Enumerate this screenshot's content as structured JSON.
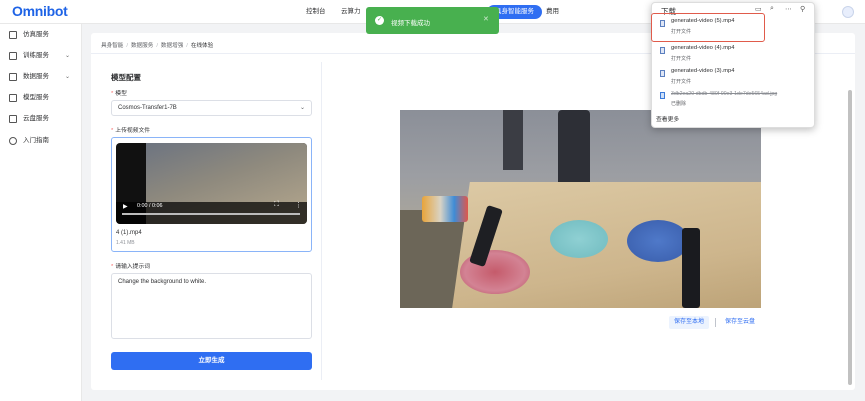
{
  "app": {
    "logo": "Omnibot"
  },
  "topnav": {
    "items": [
      "控制台",
      "云算力"
    ],
    "active": "具身智能服务",
    "billing": "费用"
  },
  "sidebar": {
    "items": [
      {
        "label": "仿真服务",
        "icon": "simulation-icon",
        "has_chevron": false
      },
      {
        "label": "训练服务",
        "icon": "training-icon",
        "has_chevron": true
      },
      {
        "label": "数据服务",
        "icon": "data-icon",
        "has_chevron": true
      },
      {
        "label": "模型服务",
        "icon": "model-icon",
        "has_chevron": false
      },
      {
        "label": "云盘服务",
        "icon": "cloud-disk-icon",
        "has_chevron": false
      },
      {
        "label": "入门指南",
        "icon": "guide-icon",
        "has_chevron": false
      }
    ]
  },
  "breadcrumb": [
    "具身智能",
    "数据服务",
    "数据增强",
    "在线体验"
  ],
  "config": {
    "title": "模型配置",
    "model_label": "模型",
    "model_value": "Cosmos-Transfer1-7B",
    "upload_label": "上传视频文件",
    "video": {
      "current_time": "0:00 / 0:06",
      "file_name": "4 (1).mp4",
      "file_size": "1.41 MB"
    },
    "prompt_label": "请输入提示词",
    "prompt_value": "Change the background to white.",
    "generate_label": "立即生成"
  },
  "result": {
    "save_local": "保存至本地",
    "save_cloud": "保存至云盘"
  },
  "toast": {
    "message": "视频下载成功",
    "color": "#48b04f"
  },
  "downloads": {
    "title": "下载",
    "items": [
      {
        "name": "generated-video (5).mp4",
        "action": "打开文件",
        "highlighted": true
      },
      {
        "name": "generated-video (4).mp4",
        "action": "打开文件",
        "highlighted": false
      },
      {
        "name": "generated-video (3).mp4",
        "action": "打开文件",
        "highlighted": false
      },
      {
        "name": "3db2ea20-dbdb-480f-90e3-1de7de5654ad.jpg",
        "action": "已删除",
        "deleted": true
      }
    ],
    "see_more": "查看更多"
  },
  "colors": {
    "accent": "#2f6ef2",
    "highlight_border": "#e05b4b"
  }
}
